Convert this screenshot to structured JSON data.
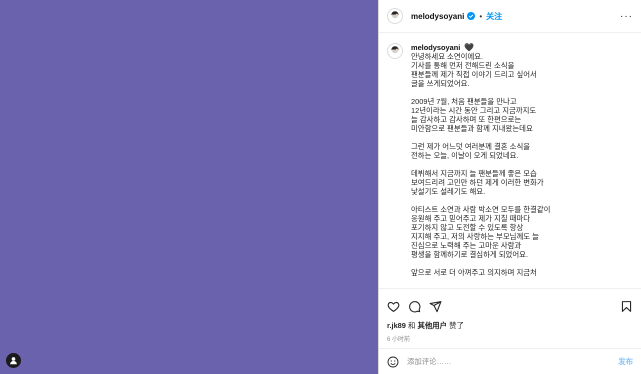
{
  "colors": {
    "media_bg": "#6b62ad",
    "accent": "#0095f6",
    "verified": "#0095f6"
  },
  "header": {
    "username": "melodysoyani",
    "follow_label": "关注",
    "more": "···"
  },
  "caption": {
    "username": "melodysoyani",
    "heart": "🖤",
    "paragraphs": [
      [
        "안녕하세요 소연이에요.",
        "기사를 통해 먼저 전해드린 소식을",
        "팬분들께 제가 직접 이야기 드리고 싶어서",
        "글을 쓰게되었어요."
      ],
      [
        "2009년 7월, 처음 팬분들을 만나고",
        "12년이라는 시간 동안 그리고 지금까지도",
        "늘 감사하고 감사하며 또 한편으로는",
        "미안함으로 팬분들과 함께 지내왔는데요"
      ],
      [
        "그런 제가 어느덧 여러분께 결혼 소식을",
        "전하는 오늘, 이날이 오게 되었네요."
      ],
      [
        "데뷔해서 지금까지 늘 팬분들께 좋은 모습",
        "보여드리려 고민만 하던 제게 이러한 변화가",
        "낯설기도 설레기도 해요."
      ],
      [
        "아티스트 소연과 사람 박소연 모두를 한결같이",
        "응원해 주고 믿어주고 제가 지칠 때마다",
        "포기하지 않고 도전할 수 있도록 항상",
        "지지해 주고, 저의 사랑하는 부모님께도 늘",
        "진심으로 노력해 주는 고마운 사람과",
        "평생을 함께하기로 결심하게 되었어요."
      ],
      [
        "앞으로 서로 더 아껴주고 의지하며 지금처"
      ]
    ]
  },
  "likes": {
    "user": "r.jk89",
    "and": "和",
    "others": "其他用户",
    "suffix": "赞了"
  },
  "time": "6 小时前",
  "comment": {
    "placeholder": "添加评论……",
    "post_label": "发布"
  }
}
